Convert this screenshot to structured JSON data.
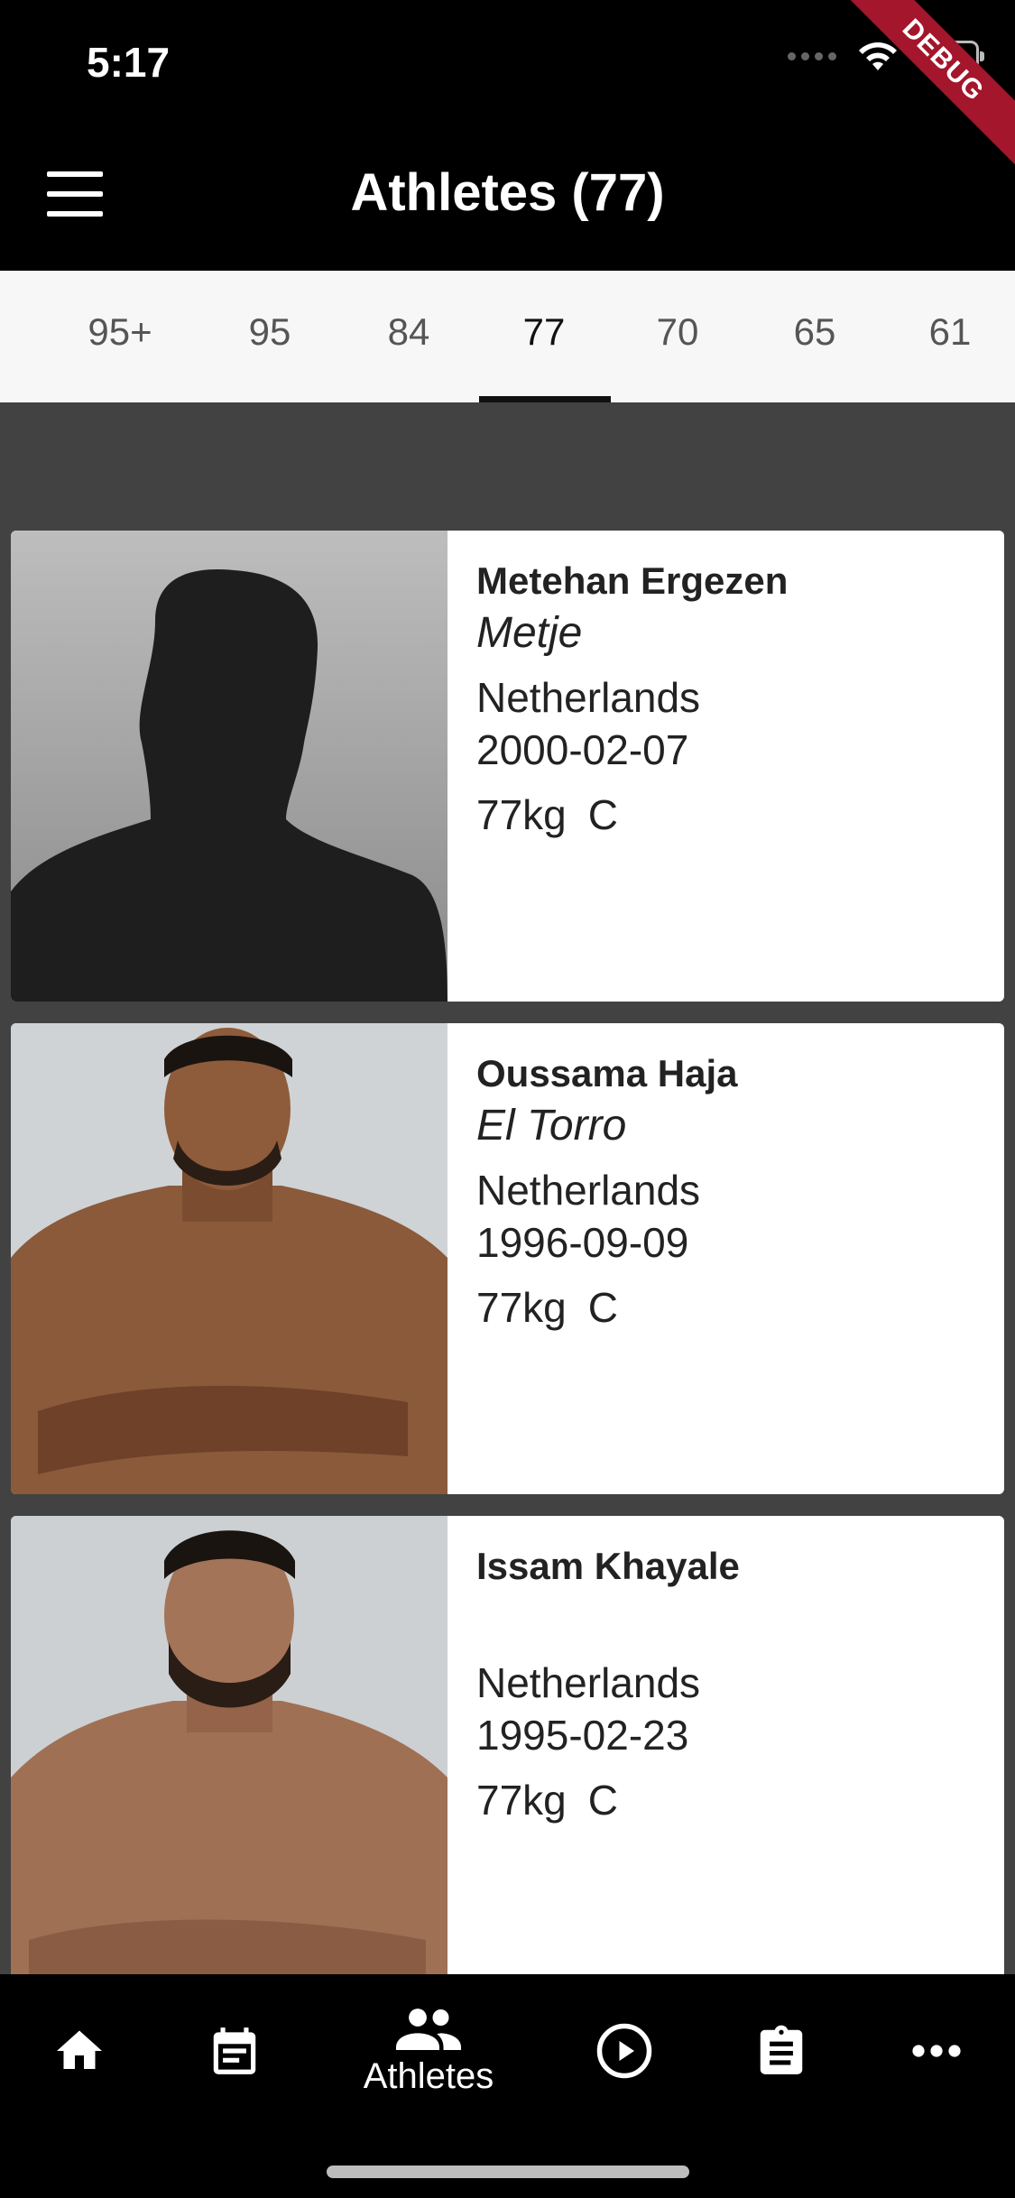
{
  "status_bar": {
    "time": "5:17",
    "debug": "DEBUG"
  },
  "app_bar": {
    "title": "Athletes (77)"
  },
  "tabs": [
    {
      "label": "95+"
    },
    {
      "label": "95"
    },
    {
      "label": "84"
    },
    {
      "label": "77",
      "active": true
    },
    {
      "label": "70"
    },
    {
      "label": "65"
    },
    {
      "label": "61"
    }
  ],
  "athletes": [
    {
      "name": "Metehan Ergezen",
      "nickname": "Metje",
      "country": "Netherlands",
      "dob": "2000-02-07",
      "weight": "77kg",
      "class": "C"
    },
    {
      "name": "Oussama Haja",
      "nickname": "El Torro",
      "country": "Netherlands",
      "dob": "1996-09-09",
      "weight": "77kg",
      "class": "C"
    },
    {
      "name": "Issam Khayale",
      "nickname": "",
      "country": "Netherlands",
      "dob": "1995-02-23",
      "weight": "77kg",
      "class": "C"
    }
  ],
  "bottom_nav": [
    {
      "icon": "home-icon",
      "label": ""
    },
    {
      "icon": "schedule-icon",
      "label": ""
    },
    {
      "icon": "people-icon",
      "label": "Athletes",
      "active": true
    },
    {
      "icon": "play-circle-icon",
      "label": ""
    },
    {
      "icon": "clipboard-icon",
      "label": ""
    },
    {
      "icon": "more-horizontal-icon",
      "label": ""
    }
  ],
  "colors": {
    "app_bar": "#000000",
    "background": "#424242",
    "tabs_bg": "#f7f7f7",
    "debug_ribbon": "#a3162b"
  }
}
